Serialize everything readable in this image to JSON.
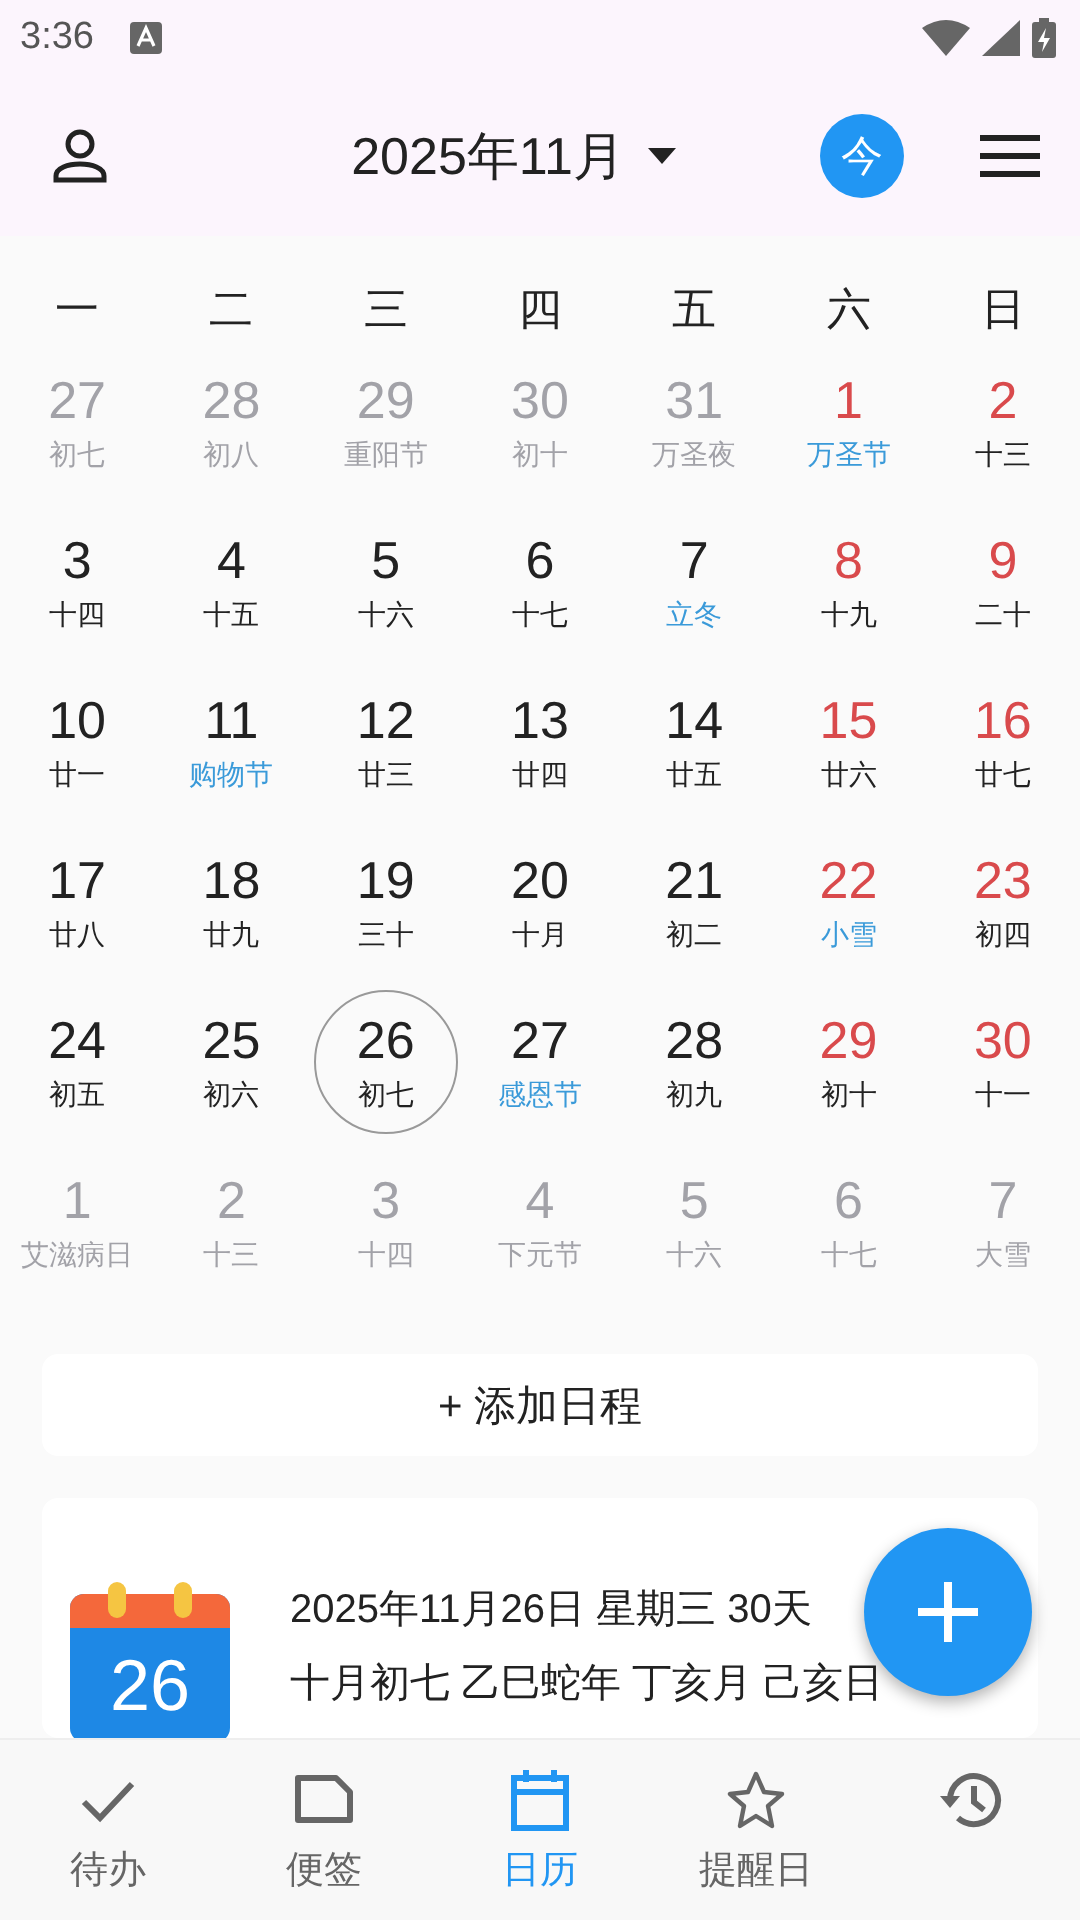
{
  "status_bar": {
    "time": "3:36"
  },
  "header": {
    "title": "2025年11月",
    "today_button": "今"
  },
  "weekdays": [
    "一",
    "二",
    "三",
    "四",
    "五",
    "六",
    "日"
  ],
  "days": [
    {
      "day": "27",
      "sub": "初七",
      "other_month": true,
      "weekend": false,
      "festival": false,
      "selected": false
    },
    {
      "day": "28",
      "sub": "初八",
      "other_month": true,
      "weekend": false,
      "festival": false,
      "selected": false
    },
    {
      "day": "29",
      "sub": "重阳节",
      "other_month": true,
      "weekend": false,
      "festival": false,
      "selected": false
    },
    {
      "day": "30",
      "sub": "初十",
      "other_month": true,
      "weekend": false,
      "festival": false,
      "selected": false
    },
    {
      "day": "31",
      "sub": "万圣夜",
      "other_month": true,
      "weekend": false,
      "festival": false,
      "selected": false
    },
    {
      "day": "1",
      "sub": "万圣节",
      "other_month": false,
      "weekend": true,
      "festival": true,
      "selected": false
    },
    {
      "day": "2",
      "sub": "十三",
      "other_month": false,
      "weekend": true,
      "festival": false,
      "selected": false
    },
    {
      "day": "3",
      "sub": "十四",
      "other_month": false,
      "weekend": false,
      "festival": false,
      "selected": false
    },
    {
      "day": "4",
      "sub": "十五",
      "other_month": false,
      "weekend": false,
      "festival": false,
      "selected": false
    },
    {
      "day": "5",
      "sub": "十六",
      "other_month": false,
      "weekend": false,
      "festival": false,
      "selected": false
    },
    {
      "day": "6",
      "sub": "十七",
      "other_month": false,
      "weekend": false,
      "festival": false,
      "selected": false
    },
    {
      "day": "7",
      "sub": "立冬",
      "other_month": false,
      "weekend": false,
      "festival": true,
      "selected": false
    },
    {
      "day": "8",
      "sub": "十九",
      "other_month": false,
      "weekend": true,
      "festival": false,
      "selected": false
    },
    {
      "day": "9",
      "sub": "二十",
      "other_month": false,
      "weekend": true,
      "festival": false,
      "selected": false
    },
    {
      "day": "10",
      "sub": "廿一",
      "other_month": false,
      "weekend": false,
      "festival": false,
      "selected": false
    },
    {
      "day": "11",
      "sub": "购物节",
      "other_month": false,
      "weekend": false,
      "festival": true,
      "selected": false
    },
    {
      "day": "12",
      "sub": "廿三",
      "other_month": false,
      "weekend": false,
      "festival": false,
      "selected": false
    },
    {
      "day": "13",
      "sub": "廿四",
      "other_month": false,
      "weekend": false,
      "festival": false,
      "selected": false
    },
    {
      "day": "14",
      "sub": "廿五",
      "other_month": false,
      "weekend": false,
      "festival": false,
      "selected": false
    },
    {
      "day": "15",
      "sub": "廿六",
      "other_month": false,
      "weekend": true,
      "festival": false,
      "selected": false
    },
    {
      "day": "16",
      "sub": "廿七",
      "other_month": false,
      "weekend": true,
      "festival": false,
      "selected": false
    },
    {
      "day": "17",
      "sub": "廿八",
      "other_month": false,
      "weekend": false,
      "festival": false,
      "selected": false
    },
    {
      "day": "18",
      "sub": "廿九",
      "other_month": false,
      "weekend": false,
      "festival": false,
      "selected": false
    },
    {
      "day": "19",
      "sub": "三十",
      "other_month": false,
      "weekend": false,
      "festival": false,
      "selected": false
    },
    {
      "day": "20",
      "sub": "十月",
      "other_month": false,
      "weekend": false,
      "festival": false,
      "selected": false
    },
    {
      "day": "21",
      "sub": "初二",
      "other_month": false,
      "weekend": false,
      "festival": false,
      "selected": false
    },
    {
      "day": "22",
      "sub": "小雪",
      "other_month": false,
      "weekend": true,
      "festival": true,
      "selected": false
    },
    {
      "day": "23",
      "sub": "初四",
      "other_month": false,
      "weekend": true,
      "festival": false,
      "selected": false
    },
    {
      "day": "24",
      "sub": "初五",
      "other_month": false,
      "weekend": false,
      "festival": false,
      "selected": false
    },
    {
      "day": "25",
      "sub": "初六",
      "other_month": false,
      "weekend": false,
      "festival": false,
      "selected": false
    },
    {
      "day": "26",
      "sub": "初七",
      "other_month": false,
      "weekend": false,
      "festival": false,
      "selected": true
    },
    {
      "day": "27",
      "sub": "感恩节",
      "other_month": false,
      "weekend": false,
      "festival": true,
      "selected": false
    },
    {
      "day": "28",
      "sub": "初九",
      "other_month": false,
      "weekend": false,
      "festival": false,
      "selected": false
    },
    {
      "day": "29",
      "sub": "初十",
      "other_month": false,
      "weekend": true,
      "festival": false,
      "selected": false
    },
    {
      "day": "30",
      "sub": "十一",
      "other_month": false,
      "weekend": true,
      "festival": false,
      "selected": false
    },
    {
      "day": "1",
      "sub": "艾滋病日",
      "other_month": true,
      "weekend": false,
      "festival": false,
      "selected": false
    },
    {
      "day": "2",
      "sub": "十三",
      "other_month": true,
      "weekend": false,
      "festival": false,
      "selected": false
    },
    {
      "day": "3",
      "sub": "十四",
      "other_month": true,
      "weekend": false,
      "festival": false,
      "selected": false
    },
    {
      "day": "4",
      "sub": "下元节",
      "other_month": true,
      "weekend": false,
      "festival": false,
      "selected": false
    },
    {
      "day": "5",
      "sub": "十六",
      "other_month": true,
      "weekend": false,
      "festival": false,
      "selected": false
    },
    {
      "day": "6",
      "sub": "十七",
      "other_month": true,
      "weekend": true,
      "festival": false,
      "selected": false
    },
    {
      "day": "7",
      "sub": "大雪",
      "other_month": true,
      "weekend": true,
      "festival": false,
      "selected": false
    }
  ],
  "add_schedule": "+ 添加日程",
  "date_card": {
    "icon_day": "26",
    "lines": [
      "2025年11月26日 星期三 30天",
      "十月初七 乙巳蛇年 丁亥月 己亥日"
    ]
  },
  "bottom_nav": [
    {
      "kind": "check",
      "label": "待办",
      "selected": false
    },
    {
      "kind": "note",
      "label": "便签",
      "selected": false
    },
    {
      "kind": "calendar",
      "label": "日历",
      "selected": true
    },
    {
      "kind": "star",
      "label": "提醒日",
      "selected": false
    },
    {
      "kind": "history",
      "selected": false
    }
  ]
}
